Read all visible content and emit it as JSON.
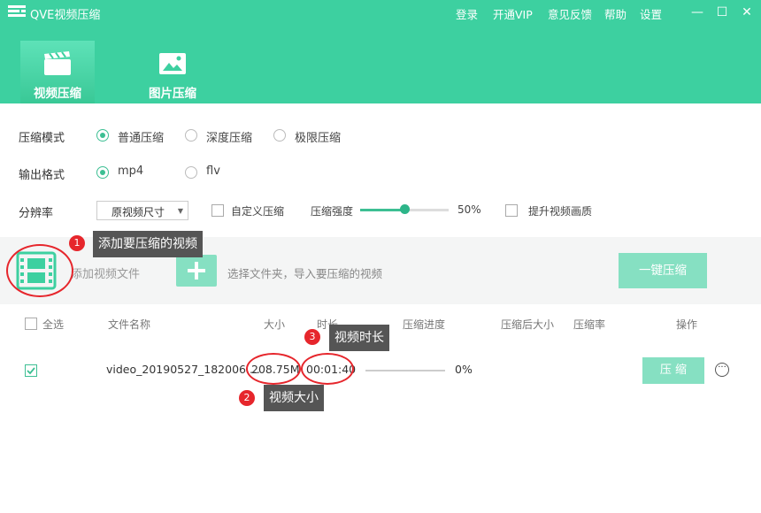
{
  "app": {
    "title": "QVE视频压缩",
    "top_links": [
      "登录",
      "开通VIP",
      "意见反馈",
      "帮助",
      "设置"
    ],
    "window_controls": [
      "—",
      "☐",
      "✕"
    ]
  },
  "tabs": [
    {
      "label": "视频压缩",
      "active": true,
      "icon": "clapperboard-icon"
    },
    {
      "label": "图片压缩",
      "active": false,
      "icon": "image-icon"
    }
  ],
  "settings": {
    "mode_label": "压缩模式",
    "modes": [
      {
        "label": "普通压缩",
        "selected": true
      },
      {
        "label": "深度压缩",
        "selected": false
      },
      {
        "label": "极限压缩",
        "selected": false
      }
    ],
    "format_label": "输出格式",
    "formats": [
      {
        "label": "mp4",
        "selected": true
      },
      {
        "label": "flv",
        "selected": false
      }
    ],
    "resolution_label": "分辨率",
    "resolution_value": "原视频尺寸",
    "custom_label": "自定义压缩",
    "custom_checked": false,
    "strength_label": "压缩强度",
    "strength_value": "50%",
    "strength_fraction": 0.5,
    "quality_label": "提升视频画质",
    "quality_checked": false
  },
  "dropzone": {
    "add_text": "添加视频文件",
    "folder_text": "选择文件夹，导入要压缩的视频",
    "compress_all_label": "一键压缩"
  },
  "table": {
    "select_all_label": "全选",
    "columns": [
      "文件名称",
      "大小",
      "时长",
      "压缩进度",
      "压缩后大小",
      "压缩率",
      "操作"
    ],
    "rows": [
      {
        "checked": true,
        "name": "video_20190527_182006....",
        "size": "208.75M",
        "duration": "00:01:40",
        "progress": "0%",
        "progress_fraction": 0,
        "action_label": "压 缩"
      }
    ]
  },
  "annotations": [
    {
      "number": "1",
      "text": "添加要压缩的视频"
    },
    {
      "number": "2",
      "text": "视频大小"
    },
    {
      "number": "3",
      "text": "视频时长"
    }
  ],
  "colors": {
    "brand": "#3dd0a0",
    "accent": "#3dbf93",
    "button_light": "#86e0c2",
    "annotation_red": "#e6262c"
  }
}
